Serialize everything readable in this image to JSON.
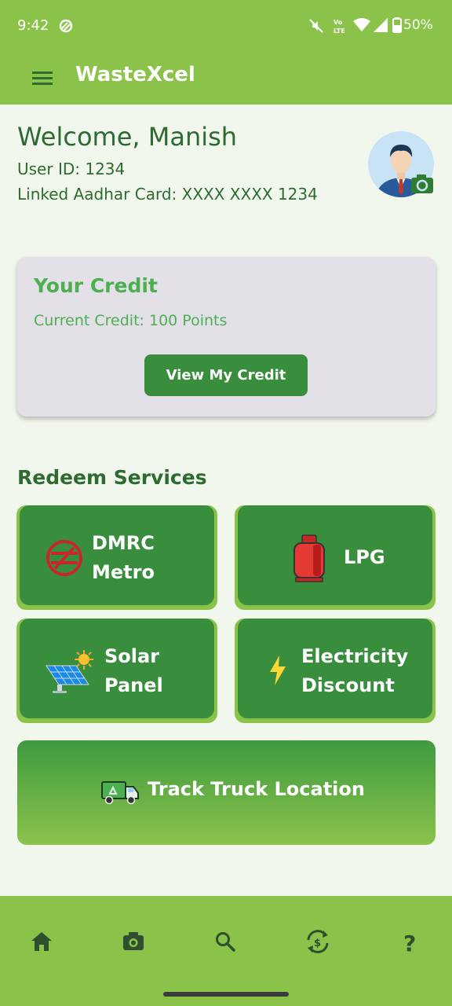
{
  "status_bar": {
    "time": "9:42",
    "battery": "50%",
    "icons": [
      "sync-icon",
      "mute-icon",
      "volte-icon",
      "wifi-icon",
      "signal-icon",
      "battery-icon"
    ]
  },
  "app_bar": {
    "title": "WasteXcel",
    "menu_icon": "hamburger-icon"
  },
  "user": {
    "welcome": "Welcome, Manish",
    "user_id": "User ID: 1234",
    "aadhar": "Linked Aadhar Card: XXXX XXXX 1234",
    "avatar_icon": "avatar-with-camera-icon"
  },
  "credit": {
    "title": "Your Credit",
    "current": "Current Credit: 100 Points",
    "button": "View My Credit"
  },
  "redeem": {
    "title": "Redeem Services",
    "tiles": [
      {
        "line1": "DMRC",
        "line2": "Metro",
        "icon": "metro-logo-icon"
      },
      {
        "line1": "LPG",
        "line2": "",
        "icon": "gas-cylinder-icon"
      },
      {
        "line1": "Solar",
        "line2": "Panel",
        "icon": "solar-panel-icon"
      },
      {
        "line1": "Electricity",
        "line2": "Discount",
        "icon": "lightning-icon"
      }
    ]
  },
  "track": {
    "label": "Track Truck Location",
    "icon": "recycling-truck-icon"
  },
  "bottom_nav": [
    {
      "icon": "home-icon"
    },
    {
      "icon": "camera-icon"
    },
    {
      "icon": "search-icon"
    },
    {
      "icon": "currency-exchange-icon"
    },
    {
      "icon": "help-icon"
    }
  ],
  "colors": {
    "primary": "#8bc34a",
    "dark_green": "#388e3c",
    "text_green": "#2e6b30",
    "credit_green": "#4caf50",
    "background": "#f1f7ec",
    "card": "#e4e0e8"
  }
}
